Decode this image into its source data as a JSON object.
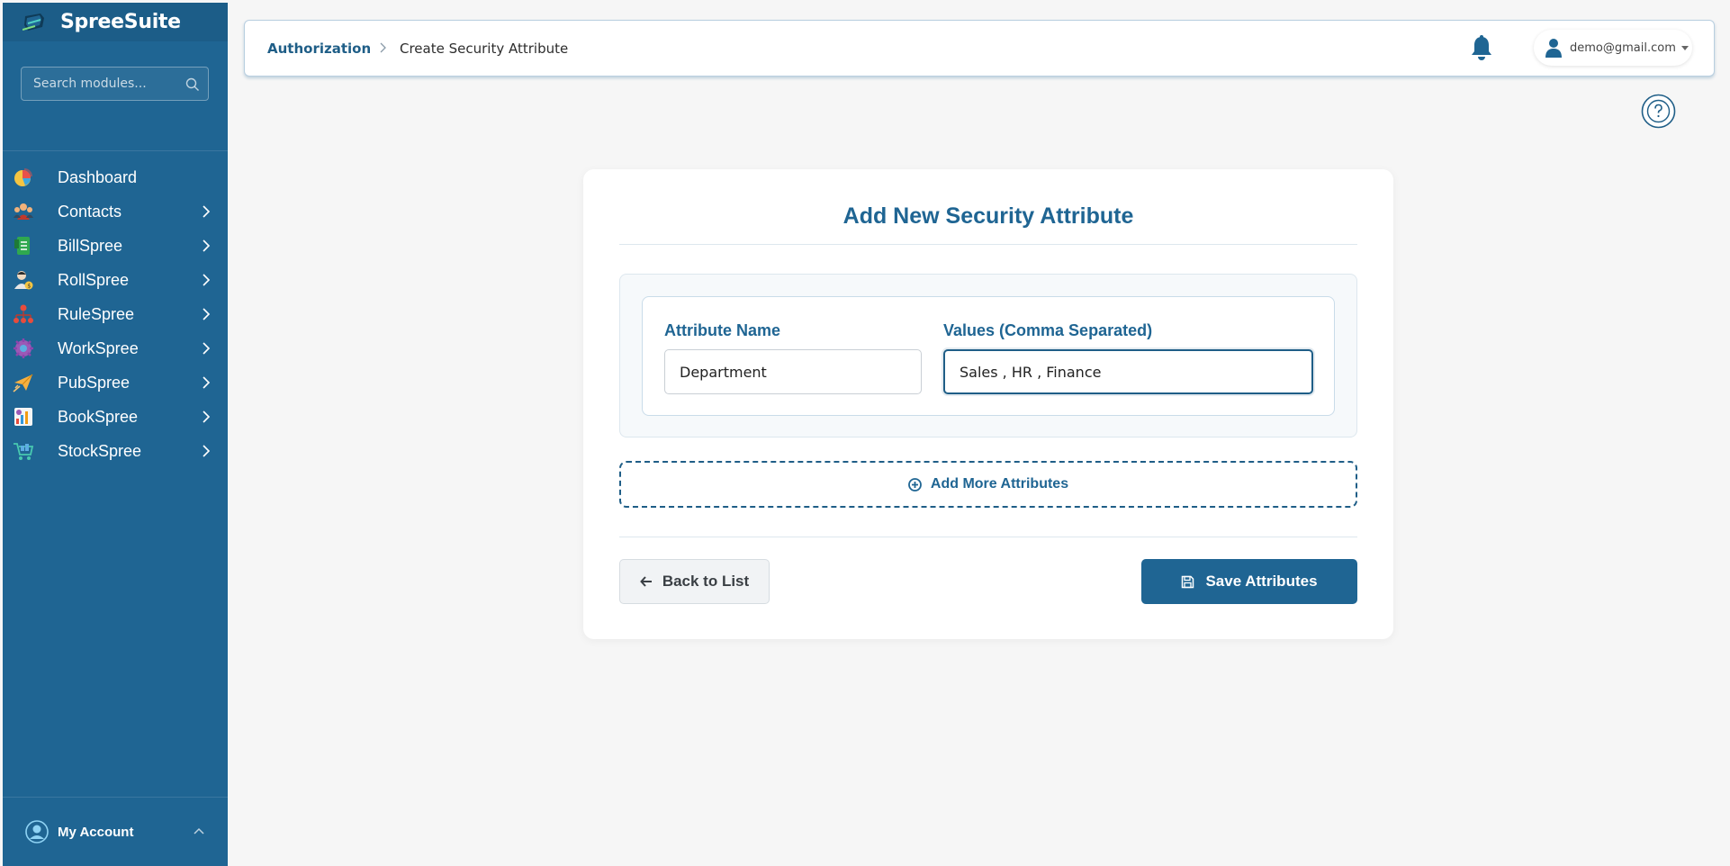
{
  "app": {
    "name": "SpreeSuite"
  },
  "sidebar": {
    "search_placeholder": "Search modules...",
    "items": [
      {
        "label": "Dashboard",
        "icon": "dashboard-pie-icon",
        "has_submenu": false
      },
      {
        "label": "Contacts",
        "icon": "contacts-people-icon",
        "has_submenu": true
      },
      {
        "label": "BillSpree",
        "icon": "bill-document-icon",
        "has_submenu": true
      },
      {
        "label": "RollSpree",
        "icon": "payroll-person-icon",
        "has_submenu": true
      },
      {
        "label": "RuleSpree",
        "icon": "rules-org-icon",
        "has_submenu": true
      },
      {
        "label": "WorkSpree",
        "icon": "workflow-gear-icon",
        "has_submenu": true
      },
      {
        "label": "PubSpree",
        "icon": "publish-paperplane-icon",
        "has_submenu": true
      },
      {
        "label": "BookSpree",
        "icon": "books-chart-icon",
        "has_submenu": true
      },
      {
        "label": "StockSpree",
        "icon": "stock-cart-icon",
        "has_submenu": true
      }
    ],
    "account_label": "My Account"
  },
  "header": {
    "breadcrumb_root": "Authorization",
    "breadcrumb_current": "Create Security Attribute",
    "user_email": "demo@gmail.com"
  },
  "form": {
    "title": "Add New Security Attribute",
    "attribute_name_label": "Attribute Name",
    "attribute_name_value": "Department",
    "values_label": "Values (Comma Separated)",
    "values_value": "Sales , HR , Finance",
    "add_more_label": "Add More Attributes",
    "back_label": "Back to List",
    "save_label": "Save Attributes"
  },
  "colors": {
    "primary": "#1f6593",
    "sidebar_bg": "#1f6593",
    "page_bg": "#f6f6f6"
  }
}
